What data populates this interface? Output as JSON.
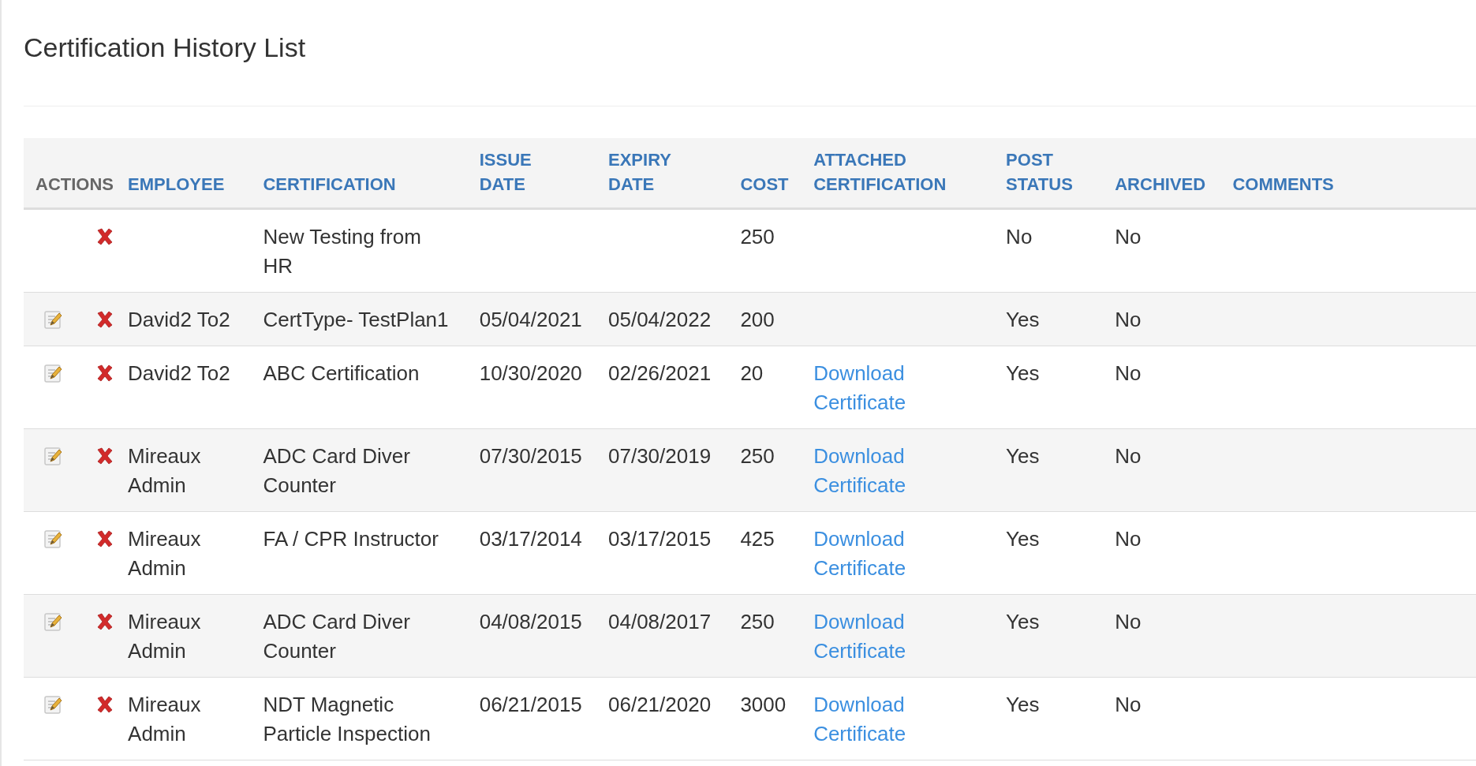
{
  "title": "Certification History List",
  "table": {
    "columns": [
      {
        "label": "ACTIONS",
        "sortable": false
      },
      {
        "label": "EMPLOYEE",
        "sortable": true
      },
      {
        "label": "CERTIFICATION",
        "sortable": true
      },
      {
        "label": "ISSUE DATE",
        "sortable": true
      },
      {
        "label": "EXPIRY DATE",
        "sortable": true
      },
      {
        "label": "COST",
        "sortable": true
      },
      {
        "label": "ATTACHED CERTIFICATION",
        "sortable": true
      },
      {
        "label": "POST STATUS",
        "sortable": true
      },
      {
        "label": "ARCHIVED",
        "sortable": true
      },
      {
        "label": "COMMENTS",
        "sortable": true
      }
    ],
    "rows": [
      {
        "editable": false,
        "employee": "",
        "certification": "New Testing from HR",
        "issue_date": "",
        "expiry_date": "",
        "cost": "250",
        "attachment": "",
        "post_status": "No",
        "archived": "No"
      },
      {
        "editable": true,
        "employee": "David2 To2",
        "certification": "CertType- TestPlan1",
        "issue_date": "05/04/2021",
        "expiry_date": "05/04/2022",
        "cost": "200",
        "attachment": "",
        "post_status": "Yes",
        "archived": "No"
      },
      {
        "editable": true,
        "employee": "David2 To2",
        "certification": "ABC Certification",
        "issue_date": "10/30/2020",
        "expiry_date": "02/26/2021",
        "cost": "20",
        "attachment": "Download Certificate",
        "post_status": "Yes",
        "archived": "No"
      },
      {
        "editable": true,
        "employee": "Mireaux Admin",
        "certification": "ADC Card Diver Counter",
        "issue_date": "07/30/2015",
        "expiry_date": "07/30/2019",
        "cost": "250",
        "attachment": "Download Certificate",
        "post_status": "Yes",
        "archived": "No"
      },
      {
        "editable": true,
        "employee": "Mireaux Admin",
        "certification": "FA / CPR Instructor",
        "issue_date": "03/17/2014",
        "expiry_date": "03/17/2015",
        "cost": "425",
        "attachment": "Download Certificate",
        "post_status": "Yes",
        "archived": "No"
      },
      {
        "editable": true,
        "employee": "Mireaux Admin",
        "certification": "ADC Card Diver Counter",
        "issue_date": "04/08/2015",
        "expiry_date": "04/08/2017",
        "cost": "250",
        "attachment": "Download Certificate",
        "post_status": "Yes",
        "archived": "No"
      },
      {
        "editable": true,
        "employee": "Mireaux Admin",
        "certification": "NDT Magnetic Particle Inspection",
        "issue_date": "06/21/2015",
        "expiry_date": "06/21/2020",
        "cost": "3000",
        "attachment": "Download Certificate",
        "post_status": "Yes",
        "archived": "No"
      }
    ]
  }
}
